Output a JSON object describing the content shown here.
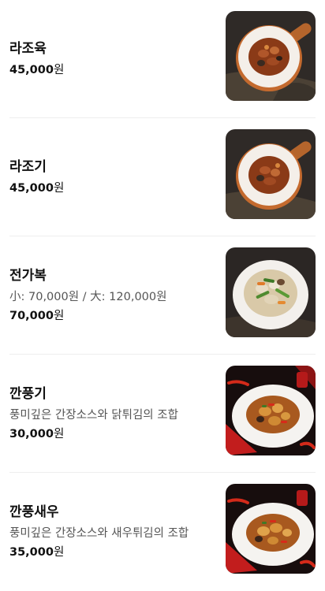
{
  "menu": {
    "items": [
      {
        "name": "라조육",
        "description": "",
        "price_value": "45,000",
        "price_unit": "원",
        "image": "braised-pork-dish-photo"
      },
      {
        "name": "라조기",
        "description": "",
        "price_value": "45,000",
        "price_unit": "원",
        "image": "braised-chicken-dish-photo"
      },
      {
        "name": "전가복",
        "description": "小: 70,000원 / 大: 120,000원",
        "price_value": "70,000",
        "price_unit": "원",
        "image": "seafood-stirfry-dish-photo"
      },
      {
        "name": "깐풍기",
        "description": "풍미깊은 간장소스와 닭튀김의 조합",
        "price_value": "30,000",
        "price_unit": "원",
        "image": "kkanpunggi-dish-photo"
      },
      {
        "name": "깐풍새우",
        "description": "풍미깊은 간장소스와 새우튀김의 조합",
        "price_value": "35,000",
        "price_unit": "원",
        "image": "kkanpung-shrimp-dish-photo"
      }
    ]
  }
}
